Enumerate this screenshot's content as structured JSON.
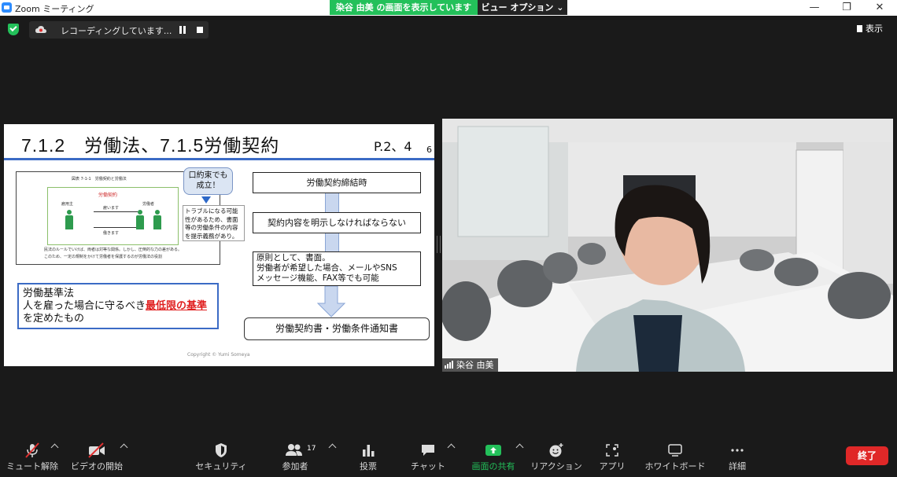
{
  "window": {
    "title": "Zoom ミーティング",
    "share_banner": "染谷 由美 の画面を表示しています",
    "view_options": "ビュー オプション ⌄",
    "minimize": "—",
    "restore": "❐",
    "close": "✕"
  },
  "recording": {
    "label": "レコーディングしています..."
  },
  "show_button": "表示",
  "slide": {
    "title": "7.1.2　労働法、7.1.5労働契約",
    "page_ref": "P.2、4",
    "slide_number": "6",
    "figure": {
      "caption": "図表 7-1-1　労働契約と労働法",
      "contract": "労働契約",
      "employer": "雇用主",
      "worker": "労働者",
      "hire": "雇います",
      "work": "働きます",
      "note1": "民法のルールでいけば、両者は対等な関係。しかし、圧倒的な力の差がある。",
      "note2": "このため、一定の規制をかけて労働者を保護するのが労働法の役割"
    },
    "bubble": "口約束でも\n成立！",
    "trouble_note": "トラブルになる可能性があるため、書面等の労働条件の内容を提示義務があり。",
    "law_line1": "労働基準法",
    "law_line2_prefix": "人を雇った場合に守るべき",
    "law_line2_emphasis": "最低限の基準",
    "law_line3": "を定めたもの",
    "flow": {
      "step1": "労働契約締結時",
      "step2": "契約内容を明示しなければならない",
      "step3_line1": "原則として、書面。",
      "step3_line2": "労働者が希望した場合、メールやSNS",
      "step3_line3": "メッセージ機能、FAX等でも可能",
      "final": "労働契約書・労働条件通知書"
    },
    "copyright": "Copyright © Yumi Someya"
  },
  "video": {
    "participant_name": "染谷 由美"
  },
  "toolbar": {
    "mute": "ミュート解除",
    "video": "ビデオの開始",
    "security": "セキュリティ",
    "participants": "参加者",
    "participants_count": "17",
    "polls": "投票",
    "chat": "チャット",
    "share": "画面の共有",
    "reactions": "リアクション",
    "apps": "アプリ",
    "whiteboard": "ホワイトボード",
    "more": "詳細",
    "end": "終了"
  },
  "colors": {
    "share_green": "#23c05a",
    "end_red": "#e02828",
    "slide_blue": "#3b6bc5"
  }
}
